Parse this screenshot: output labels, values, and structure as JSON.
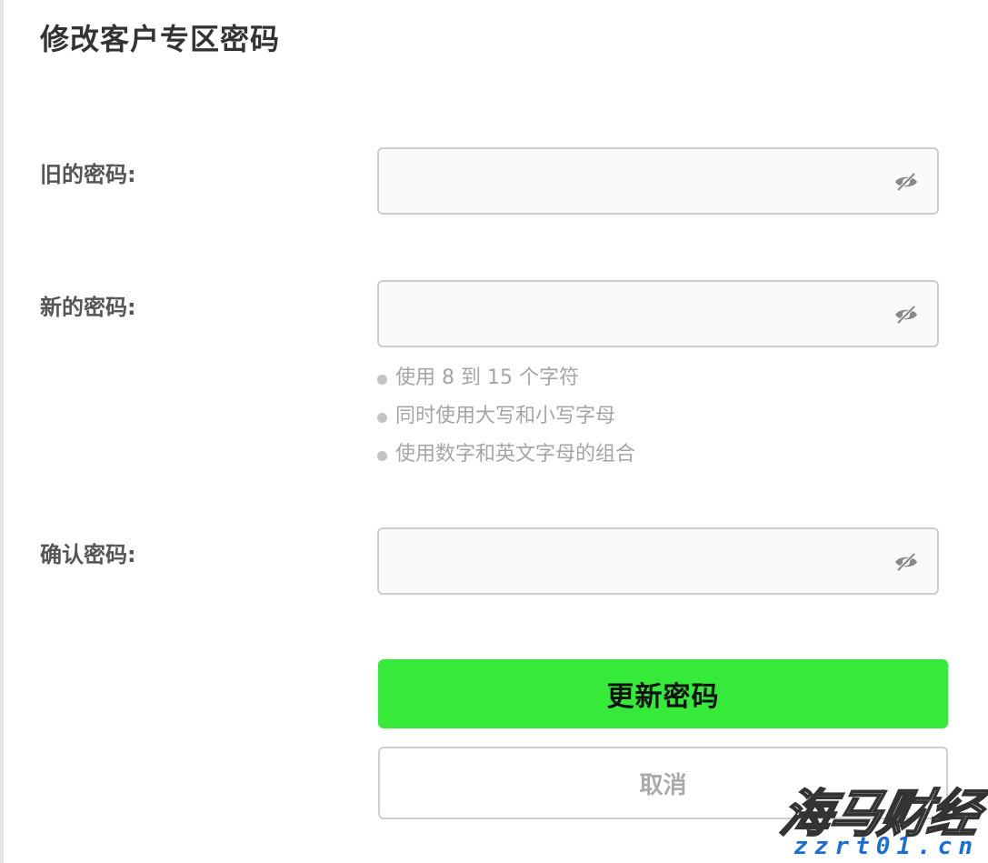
{
  "title": "修改客户专区密码",
  "fields": {
    "old_password": {
      "label": "旧的密码:",
      "value": "",
      "placeholder": ""
    },
    "new_password": {
      "label": "新的密码:",
      "value": "",
      "placeholder": ""
    },
    "confirm_password": {
      "label": "确认密码:",
      "value": "",
      "placeholder": ""
    }
  },
  "password_rules": [
    "使用 8 到 15 个字符",
    "同时使用大写和小写字母",
    "使用数字和英文字母的组合"
  ],
  "buttons": {
    "update": "更新密码",
    "cancel": "取消"
  },
  "watermark": {
    "name": "海马财经",
    "url": "zzrt01.cn"
  },
  "colors": {
    "primary_button": "#36ea3a",
    "input_border": "#cfcfcf",
    "rule_text": "#a5a5a5"
  },
  "icons": {
    "password_toggle": "eye-slash-icon"
  }
}
